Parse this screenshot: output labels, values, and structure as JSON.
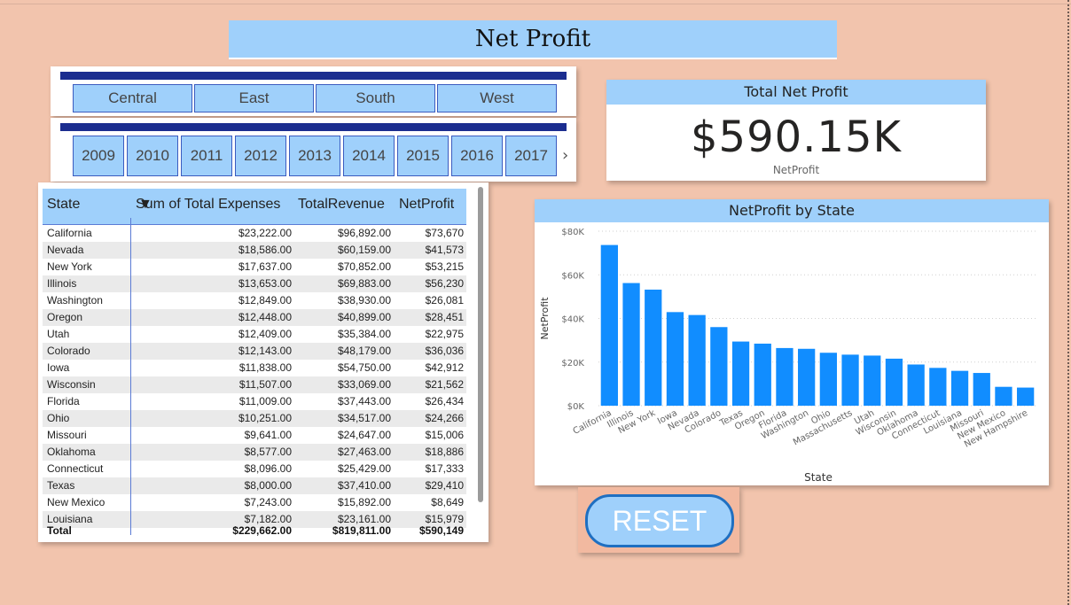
{
  "title": "Net Profit",
  "regions": [
    "Central",
    "East",
    "South",
    "West"
  ],
  "years": [
    "2009",
    "2010",
    "2011",
    "2012",
    "2013",
    "2014",
    "2015",
    "2016",
    "2017"
  ],
  "years_next_icon": "chevron-right-icon",
  "card": {
    "title": "Total Net Profit",
    "value": "$590.15K",
    "label": "NetProfit"
  },
  "table": {
    "headers": [
      "State",
      "Sum of Total Expenses",
      "TotalRevenue",
      "NetProfit"
    ],
    "rows": [
      [
        "California",
        "$23,222.00",
        "$96,892.00",
        "$73,670"
      ],
      [
        "Nevada",
        "$18,586.00",
        "$60,159.00",
        "$41,573"
      ],
      [
        "New York",
        "$17,637.00",
        "$70,852.00",
        "$53,215"
      ],
      [
        "Illinois",
        "$13,653.00",
        "$69,883.00",
        "$56,230"
      ],
      [
        "Washington",
        "$12,849.00",
        "$38,930.00",
        "$26,081"
      ],
      [
        "Oregon",
        "$12,448.00",
        "$40,899.00",
        "$28,451"
      ],
      [
        "Utah",
        "$12,409.00",
        "$35,384.00",
        "$22,975"
      ],
      [
        "Colorado",
        "$12,143.00",
        "$48,179.00",
        "$36,036"
      ],
      [
        "Iowa",
        "$11,838.00",
        "$54,750.00",
        "$42,912"
      ],
      [
        "Wisconsin",
        "$11,507.00",
        "$33,069.00",
        "$21,562"
      ],
      [
        "Florida",
        "$11,009.00",
        "$37,443.00",
        "$26,434"
      ],
      [
        "Ohio",
        "$10,251.00",
        "$34,517.00",
        "$24,266"
      ],
      [
        "Missouri",
        "$9,641.00",
        "$24,647.00",
        "$15,006"
      ],
      [
        "Oklahoma",
        "$8,577.00",
        "$27,463.00",
        "$18,886"
      ],
      [
        "Connecticut",
        "$8,096.00",
        "$25,429.00",
        "$17,333"
      ],
      [
        "Texas",
        "$8,000.00",
        "$37,410.00",
        "$29,410"
      ],
      [
        "New Mexico",
        "$7,243.00",
        "$15,892.00",
        "$8,649"
      ],
      [
        "Louisiana",
        "$7,182.00",
        "$23,161.00",
        "$15,979"
      ]
    ],
    "total": [
      "Total",
      "$229,662.00",
      "$819,811.00",
      "$590,149"
    ]
  },
  "chart_data": {
    "type": "bar",
    "title": "NetProfit by State",
    "xlabel": "State",
    "ylabel": "NetProfit",
    "ylim": [
      0,
      80000
    ],
    "yticks": [
      "$0K",
      "$20K",
      "$40K",
      "$60K",
      "$80K"
    ],
    "categories": [
      "California",
      "Illinois",
      "New York",
      "Iowa",
      "Nevada",
      "Colorado",
      "Texas",
      "Oregon",
      "Florida",
      "Washington",
      "Ohio",
      "Massachusetts",
      "Utah",
      "Wisconsin",
      "Oklahoma",
      "Connecticut",
      "Louisiana",
      "Missouri",
      "New Mexico",
      "New Hampshire"
    ],
    "values": [
      73670,
      56230,
      53215,
      42912,
      41573,
      36036,
      29410,
      28451,
      26434,
      26081,
      24266,
      23400,
      22975,
      21562,
      18886,
      17333,
      15979,
      15006,
      8649,
      8300
    ],
    "color": "#118dff",
    "grid": true
  },
  "reset_label": "RESET",
  "colors": {
    "background": "#f2c4ad",
    "header": "#9fd0fb",
    "accent": "#1b2d8f"
  }
}
